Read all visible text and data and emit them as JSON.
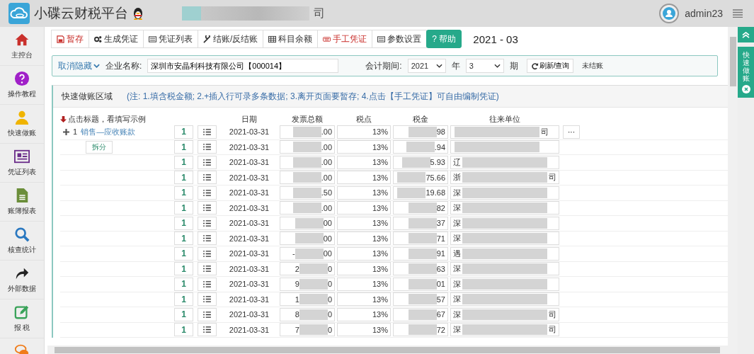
{
  "header": {
    "app_name": "小碟云财税平台",
    "company_fragment": "司",
    "username": "admin23"
  },
  "sidebar": {
    "items": [
      {
        "label": "主控台",
        "kind": "home"
      },
      {
        "label": "操作教程",
        "kind": "help"
      },
      {
        "label": "快速做账",
        "kind": "user"
      },
      {
        "label": "凭证列表",
        "kind": "list"
      },
      {
        "label": "账簿报表",
        "kind": "doc"
      },
      {
        "label": "核查统计",
        "kind": "search"
      },
      {
        "label": "外部数据",
        "kind": "share"
      },
      {
        "label": "报 税",
        "kind": "edit"
      }
    ]
  },
  "toolbar": {
    "buttons": [
      {
        "label": "暂存",
        "kind": "save"
      },
      {
        "label": "生成凭证",
        "kind": "gears"
      },
      {
        "label": "凭证列表",
        "kind": "card"
      },
      {
        "label": "结账/反结账",
        "kind": "wrench"
      },
      {
        "label": "科目余额",
        "kind": "table"
      },
      {
        "label": "手工凭证",
        "kind": "keyboard"
      },
      {
        "label": "参数设置",
        "kind": "card"
      },
      {
        "label": "? 帮助",
        "kind": "help"
      }
    ],
    "period": "2021 - 03"
  },
  "filter": {
    "toggle": "取消隐藏",
    "company_label": "企业名称:",
    "company_value": "深圳市安晶利科技有限公司【000014】",
    "period_label": "会计期间:",
    "year": "2021",
    "year_unit": "年",
    "month": "3",
    "month_unit": "期",
    "refresh": "刷新/查询",
    "status": "未结账"
  },
  "quick": {
    "title": "快速做账区域",
    "note": "(注: 1.填含税金额; 2.+插入行可录多条数据; 3.离开页面要暂存; 4.点击【手工凭证】可自由编制凭证)",
    "hint": "点击标题，看填写示例",
    "columns": [
      "日期",
      "发票总额",
      "税点",
      "税金",
      "往来单位"
    ],
    "entry": {
      "number": "1",
      "account": "销售—应收账款",
      "split": "拆分",
      "more": "···"
    },
    "rows": [
      {
        "count": "1",
        "date": "2021-03-31",
        "amount_start": "",
        "amount_end": ".00",
        "rate": "13%",
        "tax": "98",
        "partner_start": "",
        "partner_end": "司"
      },
      {
        "count": "1",
        "date": "2021-03-31",
        "amount_start": "",
        "amount_end": ".00",
        "rate": "13%",
        "tax": ".94",
        "partner_start": "",
        "partner_end": ""
      },
      {
        "count": "1",
        "date": "2021-03-31",
        "amount_start": "",
        "amount_end": ".00",
        "rate": "13%",
        "tax": "5.93",
        "partner_start": "辽",
        "partner_end": ""
      },
      {
        "count": "1",
        "date": "2021-03-31",
        "amount_start": "",
        "amount_end": ".00",
        "rate": "13%",
        "tax": "75.66",
        "partner_start": "浙",
        "partner_end": "司"
      },
      {
        "count": "1",
        "date": "2021-03-31",
        "amount_start": "",
        "amount_end": ".50",
        "rate": "13%",
        "tax": "19.68",
        "partner_start": "深",
        "partner_end": ""
      },
      {
        "count": "1",
        "date": "2021-03-31",
        "amount_start": "",
        "amount_end": ".00",
        "rate": "13%",
        "tax": "82",
        "partner_start": "深",
        "partner_end": ""
      },
      {
        "count": "1",
        "date": "2021-03-31",
        "amount_start": "",
        "amount_end": "00",
        "rate": "13%",
        "tax": "37",
        "partner_start": "深",
        "partner_end": ""
      },
      {
        "count": "1",
        "date": "2021-03-31",
        "amount_start": "",
        "amount_end": "00",
        "rate": "13%",
        "tax": "71",
        "partner_start": "深",
        "partner_end": ""
      },
      {
        "count": "1",
        "date": "2021-03-31",
        "amount_start": "-",
        "amount_end": "00",
        "rate": "13%",
        "tax": "91",
        "partner_start": "遇",
        "partner_end": ""
      },
      {
        "count": "1",
        "date": "2021-03-31",
        "amount_start": "2",
        "amount_end": "0",
        "rate": "13%",
        "tax": "63",
        "partner_start": "深",
        "partner_end": ""
      },
      {
        "count": "1",
        "date": "2021-03-31",
        "amount_start": "9",
        "amount_end": "0",
        "rate": "13%",
        "tax": "01",
        "partner_start": "深",
        "partner_end": ""
      },
      {
        "count": "1",
        "date": "2021-03-31",
        "amount_start": "1",
        "amount_end": "0",
        "rate": "13%",
        "tax": "57",
        "partner_start": "深",
        "partner_end": ""
      },
      {
        "count": "1",
        "date": "2021-03-31",
        "amount_start": "8",
        "amount_end": "0",
        "rate": "13%",
        "tax": "67",
        "partner_start": "深",
        "partner_end": "司"
      },
      {
        "count": "1",
        "date": "2021-03-31",
        "amount_start": "7",
        "amount_end": "0",
        "rate": "13%",
        "tax": "72",
        "partner_start": "深",
        "partner_end": "司"
      }
    ]
  },
  "side_tab": {
    "label": "快速做账"
  }
}
